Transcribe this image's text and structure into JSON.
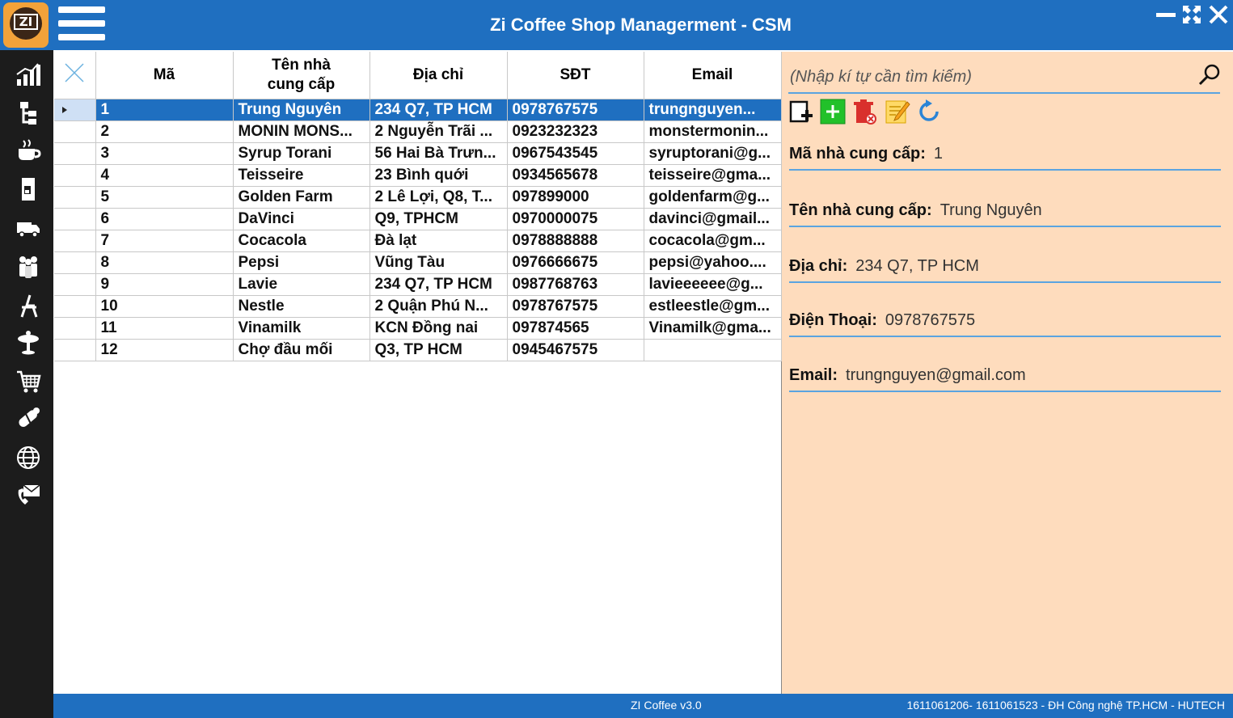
{
  "app": {
    "title": "Zi Coffee Shop Managerment - CSM",
    "logo_text": "ZI"
  },
  "sidebar": {
    "icons": [
      "chart-icon",
      "hierarchy-icon",
      "coffee-cup-icon",
      "coffee-machine-icon",
      "truck-icon",
      "people-icon",
      "chair-icon",
      "table-icon",
      "cart-icon",
      "pills-icon",
      "globe-icon",
      "contact-mail-icon"
    ]
  },
  "grid": {
    "columns": [
      "Mã",
      "Tên nhà cung cấp",
      "Địa chỉ",
      "SĐT",
      "Email"
    ],
    "rows": [
      {
        "id": "1",
        "name": "Trung Nguyên",
        "address": "234 Q7, TP HCM",
        "phone": "0978767575",
        "email": "trungnguyen..."
      },
      {
        "id": "2",
        "name": "MONIN MONS...",
        "address": "2 Nguyễn Trãi ...",
        "phone": "0923232323",
        "email": "monstermonin..."
      },
      {
        "id": "3",
        "name": "Syrup Torani",
        "address": "56 Hai Bà Trưn...",
        "phone": "0967543545",
        "email": "syruptorani@g..."
      },
      {
        "id": "4",
        "name": "Teisseire",
        "address": "23 Bình quới",
        "phone": "0934565678",
        "email": "teisseire@gma..."
      },
      {
        "id": "5",
        "name": "Golden Farm",
        "address": "2 Lê Lợi, Q8, T...",
        "phone": "097899000",
        "email": "goldenfarm@g..."
      },
      {
        "id": "6",
        "name": "DaVinci",
        "address": "Q9, TPHCM",
        "phone": "0970000075",
        "email": "davinci@gmail..."
      },
      {
        "id": "7",
        "name": "Cocacola",
        "address": "Đà lạt",
        "phone": "0978888888",
        "email": "cocacola@gm..."
      },
      {
        "id": "8",
        "name": "Pepsi",
        "address": "Vũng Tàu",
        "phone": "0976666675",
        "email": "pepsi@yahoo...."
      },
      {
        "id": "9",
        "name": "Lavie",
        "address": "234 Q7, TP HCM",
        "phone": "0987768763",
        "email": "lavieeeeee@g..."
      },
      {
        "id": "10",
        "name": "Nestle",
        "address": "2 Quận Phú N...",
        "phone": "0978767575",
        "email": "estleestle@gm..."
      },
      {
        "id": "11",
        "name": "Vinamilk",
        "address": "KCN Đồng nai",
        "phone": "097874565",
        "email": "Vinamilk@gma..."
      },
      {
        "id": "12",
        "name": "Chợ đầu mối",
        "address": "Q3, TP HCM",
        "phone": "0945467575",
        "email": ""
      }
    ],
    "selected_index": 0
  },
  "detail": {
    "search_placeholder": "(Nhập kí tự cần tìm kiếm)",
    "fields": [
      {
        "label": "Mã nhà cung cấp:",
        "value": "1"
      },
      {
        "label": "Tên nhà cung cấp:",
        "value": "Trung Nguyên"
      },
      {
        "label": "Địa chỉ:",
        "value": "234 Q7, TP HCM"
      },
      {
        "label": "Điện Thoại:",
        "value": "0978767575"
      },
      {
        "label": "Email:",
        "value": "trungnguyen@gmail.com"
      }
    ]
  },
  "status": {
    "version": "ZI Coffee v3.0",
    "credit": "1611061206- 1611061523 - ĐH Công nghệ TP.HCM - HUTECH"
  },
  "colors": {
    "primary": "#1f6fc0",
    "sidebar": "#1c1c1c",
    "detail_bg": "#fedcbd",
    "field_line": "#5aa4e0"
  }
}
